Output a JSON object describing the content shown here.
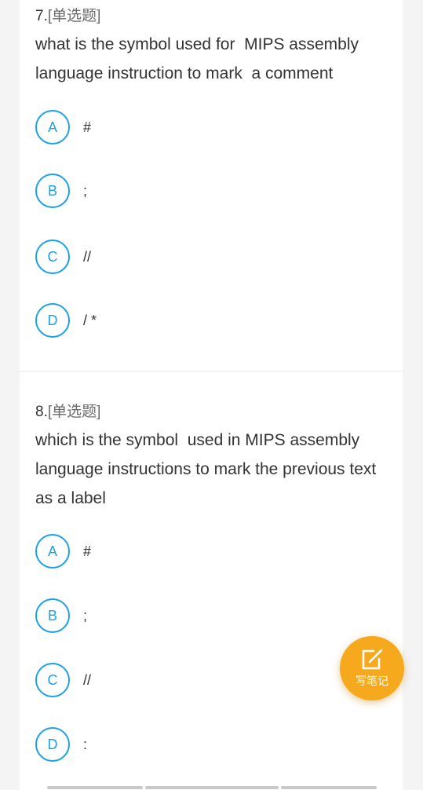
{
  "questions": [
    {
      "number": "7.",
      "type": "[单选题]",
      "text": "what is the symbol used for  MIPS assembly language instruction to mark  a comment",
      "options": [
        {
          "letter": "A",
          "text": "#"
        },
        {
          "letter": "B",
          "text": ";"
        },
        {
          "letter": "C",
          "text": "//"
        },
        {
          "letter": "D",
          "text": "/ *"
        }
      ]
    },
    {
      "number": "8.",
      "type": "[单选题]",
      "text": "which is the symbol  used in MIPS assembly language instructions to mark the previous text as a label",
      "options": [
        {
          "letter": "A",
          "text": "#"
        },
        {
          "letter": "B",
          "text": ";"
        },
        {
          "letter": "C",
          "text": "//"
        },
        {
          "letter": "D",
          "text": ":"
        }
      ]
    }
  ],
  "fab": {
    "label": "写笔记",
    "icon": "edit-note-icon"
  },
  "colors": {
    "accent": "#1da1e6",
    "fab": "#f7a91d",
    "background": "#f4f4f4"
  }
}
